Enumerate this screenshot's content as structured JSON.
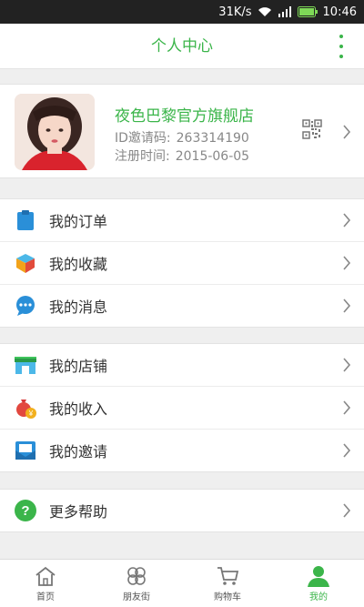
{
  "status_bar": {
    "speed": "31K/s",
    "time": "10:46"
  },
  "header": {
    "title": "个人中心",
    "menu_icon": "more-vertical-icon"
  },
  "profile": {
    "store_name": "夜色巴黎官方旗舰店",
    "invite_label": "ID邀请码:",
    "invite_code": "263314190",
    "register_label": "注册时间:",
    "register_date": "2015-06-05"
  },
  "menu_groups": {
    "orders": {
      "orders": "我的订单",
      "favorites": "我的收藏",
      "messages": "我的消息"
    },
    "shop": {
      "store": "我的店铺",
      "income": "我的收入",
      "invite": "我的邀请"
    },
    "help": {
      "help": "更多帮助"
    }
  },
  "tabbar": {
    "home": "首页",
    "friends": "朋友街",
    "cart": "购物车",
    "mine": "我的"
  },
  "colors": {
    "accent": "#3bb54a",
    "blue": "#2a8fd8",
    "background": "#efefef"
  }
}
